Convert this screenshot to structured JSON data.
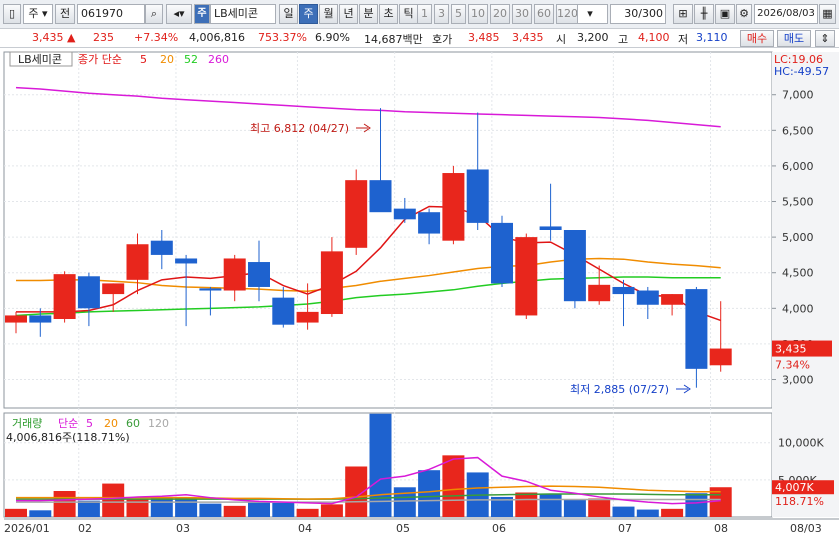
{
  "toolbar": {
    "market": "주",
    "compare": "전",
    "code": "061970",
    "name": "LB세미콘",
    "name_prefix": "주",
    "periods": [
      "일",
      "주",
      "월",
      "년",
      "분",
      "초",
      "틱"
    ],
    "active_period": "주",
    "minutes": [
      "1",
      "3",
      "5",
      "10",
      "20",
      "30",
      "60",
      "120"
    ],
    "count": "30",
    "count_max": "/300",
    "date": "2026/08/03"
  },
  "info": {
    "price": "3,435",
    "change": "235",
    "change_rate": "+7.34%",
    "volume": "4,006,816",
    "volume_ratio": "753.37%",
    "turnover": "6.90%",
    "amount": "14,687백만",
    "quote_label": "호가",
    "ask": "3,485",
    "bid": "3,435",
    "open_label": "시",
    "open": "3,200",
    "high_label": "고",
    "high": "4,100",
    "low_label": "저",
    "low": "3,110",
    "buy_label": "매수",
    "sell_label": "매도"
  },
  "colors": {
    "up": "#e8261c",
    "down": "#1e62cf",
    "ma5": "#e01515",
    "ma20": "#f08c00",
    "ma52": "#22cc22",
    "ma260": "#d81ad8",
    "vma60": "#3a9b3a",
    "vma120": "#a8a8a8"
  },
  "chart_data": {
    "type": "candlestick",
    "title": "LB세미콘",
    "legend": {
      "label": "종가 단순",
      "periods": [
        "5",
        "20",
        "52",
        "260"
      ]
    },
    "x_labels": [
      "2026/01",
      "02",
      "03",
      "04",
      "05",
      "06",
      "07",
      "08",
      "08/03"
    ],
    "y_ticks": [
      "3,000",
      "3,500",
      "4,000",
      "4,500",
      "5,000",
      "5,500",
      "6,000",
      "6,500",
      "7,000"
    ],
    "ylim": [
      2600,
      7600
    ],
    "lc": "LC:19.06",
    "hc": "HC:-49.57",
    "max_annotation": "최고 6,812 (04/27)",
    "min_annotation": "최저 2,885 (07/27)",
    "last_price": "3,435",
    "last_rate": "7.34%",
    "candles": [
      {
        "o": 3800,
        "h": 3950,
        "l": 3650,
        "c": 3900
      },
      {
        "o": 3900,
        "h": 4000,
        "l": 3600,
        "c": 3800
      },
      {
        "o": 3850,
        "h": 4520,
        "l": 3800,
        "c": 4480
      },
      {
        "o": 4450,
        "h": 4500,
        "l": 3750,
        "c": 4000
      },
      {
        "o": 4200,
        "h": 4350,
        "l": 3950,
        "c": 4350
      },
      {
        "o": 4400,
        "h": 5050,
        "l": 4200,
        "c": 4900
      },
      {
        "o": 4950,
        "h": 5100,
        "l": 4550,
        "c": 4750
      },
      {
        "o": 4700,
        "h": 4750,
        "l": 3750,
        "c": 4630
      },
      {
        "o": 4280,
        "h": 4300,
        "l": 3900,
        "c": 4250
      },
      {
        "o": 4250,
        "h": 4750,
        "l": 4100,
        "c": 4700
      },
      {
        "o": 4650,
        "h": 4950,
        "l": 4100,
        "c": 4300
      },
      {
        "o": 4150,
        "h": 4300,
        "l": 3730,
        "c": 3770
      },
      {
        "o": 3800,
        "h": 4350,
        "l": 3700,
        "c": 3950
      },
      {
        "o": 3920,
        "h": 5000,
        "l": 3880,
        "c": 4800
      },
      {
        "o": 4850,
        "h": 5950,
        "l": 4750,
        "c": 5800
      },
      {
        "o": 5800,
        "h": 6812,
        "l": 5650,
        "c": 5350
      },
      {
        "o": 5400,
        "h": 5550,
        "l": 5200,
        "c": 5250
      },
      {
        "o": 5350,
        "h": 5400,
        "l": 4900,
        "c": 5050
      },
      {
        "o": 4950,
        "h": 6000,
        "l": 4900,
        "c": 5900
      },
      {
        "o": 5950,
        "h": 6750,
        "l": 5100,
        "c": 5200
      },
      {
        "o": 5200,
        "h": 5300,
        "l": 4300,
        "c": 4350
      },
      {
        "o": 3900,
        "h": 5050,
        "l": 3850,
        "c": 5000
      },
      {
        "o": 5150,
        "h": 5750,
        "l": 4950,
        "c": 5100
      },
      {
        "o": 5100,
        "h": 5100,
        "l": 4000,
        "c": 4100
      },
      {
        "o": 4100,
        "h": 4600,
        "l": 4050,
        "c": 4330
      },
      {
        "o": 4300,
        "h": 4400,
        "l": 3750,
        "c": 4200
      },
      {
        "o": 4250,
        "h": 4300,
        "l": 3850,
        "c": 4050
      },
      {
        "o": 4050,
        "h": 4200,
        "l": 3900,
        "c": 4200
      },
      {
        "o": 4270,
        "h": 4300,
        "l": 2885,
        "c": 3150
      },
      {
        "o": 3200,
        "h": 4100,
        "l": 3110,
        "c": 3435
      }
    ],
    "ma5": [
      3950,
      3950,
      3950,
      3970,
      4050,
      4250,
      4400,
      4440,
      4420,
      4460,
      4500,
      4320,
      4200,
      4330,
      4520,
      4850,
      5250,
      5430,
      5420,
      5310,
      5000,
      4920,
      4930,
      4750,
      4550,
      4350,
      4180,
      4170,
      3950,
      3830
    ],
    "ma20": [
      4390,
      4390,
      4400,
      4400,
      4380,
      4360,
      4320,
      4300,
      4290,
      4280,
      4270,
      4250,
      4240,
      4280,
      4320,
      4380,
      4420,
      4460,
      4510,
      4560,
      4590,
      4600,
      4650,
      4690,
      4700,
      4690,
      4650,
      4620,
      4600,
      4570
    ],
    "ma52": [
      3900,
      3920,
      3930,
      3950,
      3960,
      3970,
      3980,
      3990,
      4000,
      4010,
      4020,
      4040,
      4060,
      4100,
      4150,
      4180,
      4200,
      4230,
      4260,
      4310,
      4350,
      4380,
      4410,
      4420,
      4430,
      4440,
      4440,
      4430,
      4430,
      4430
    ],
    "ma260": [
      7100,
      7080,
      7050,
      7020,
      7000,
      6980,
      6950,
      6930,
      6910,
      6890,
      6870,
      6850,
      6830,
      6810,
      6790,
      6780,
      6760,
      6750,
      6740,
      6730,
      6720,
      6710,
      6700,
      6690,
      6680,
      6660,
      6640,
      6610,
      6580,
      6550
    ],
    "volume": {
      "title": "거래량",
      "legend": {
        "label": "단순",
        "periods": [
          "5",
          "20",
          "60",
          "120"
        ]
      },
      "current": "4,006,816주(118.71%)",
      "ylim": [
        0,
        14000
      ],
      "y_ticks": [
        "5,000K",
        "10,000K"
      ],
      "last_label": "4,007K",
      "last_rate": "118.71%",
      "values": [
        1100,
        900,
        3500,
        2200,
        4500,
        2500,
        2700,
        2600,
        1800,
        1500,
        2100,
        1900,
        1100,
        1700,
        6800,
        13900,
        4000,
        6300,
        8300,
        6000,
        2700,
        3300,
        3100,
        2300,
        2500,
        1400,
        1000,
        1100,
        3200,
        4007
      ],
      "vma5": [
        2200,
        2200,
        2300,
        2400,
        2500,
        2700,
        2800,
        3000,
        2600,
        2300,
        2100,
        2000,
        1900,
        1800,
        2700,
        5100,
        5500,
        6400,
        7800,
        8000,
        5500,
        4800,
        3600,
        3200,
        2700,
        2300,
        2000,
        1800,
        1900,
        2200
      ],
      "vma20": [
        2600,
        2600,
        2600,
        2600,
        2600,
        2600,
        2600,
        2600,
        2550,
        2500,
        2500,
        2450,
        2400,
        2450,
        2700,
        3000,
        3200,
        3400,
        3700,
        3900,
        4000,
        4100,
        4150,
        4100,
        4000,
        3800,
        3600,
        3500,
        3400,
        3400
      ],
      "vma60": [
        2400,
        2400,
        2400,
        2400,
        2400,
        2400,
        2400,
        2400,
        2400,
        2400,
        2400,
        2400,
        2400,
        2400,
        2450,
        2550,
        2650,
        2750,
        2850,
        2950,
        3000,
        3050,
        3100,
        3100,
        3100,
        3100,
        3050,
        3000,
        3000,
        3000
      ],
      "vma120": [
        2000,
        2000,
        2000,
        2000,
        2000,
        2000,
        2000,
        2000,
        2000,
        2000,
        2000,
        2000,
        2000,
        2000,
        2050,
        2100,
        2150,
        2200,
        2250,
        2300,
        2300,
        2350,
        2350,
        2350,
        2350,
        2350,
        2350,
        2350,
        2350,
        2350
      ]
    }
  }
}
